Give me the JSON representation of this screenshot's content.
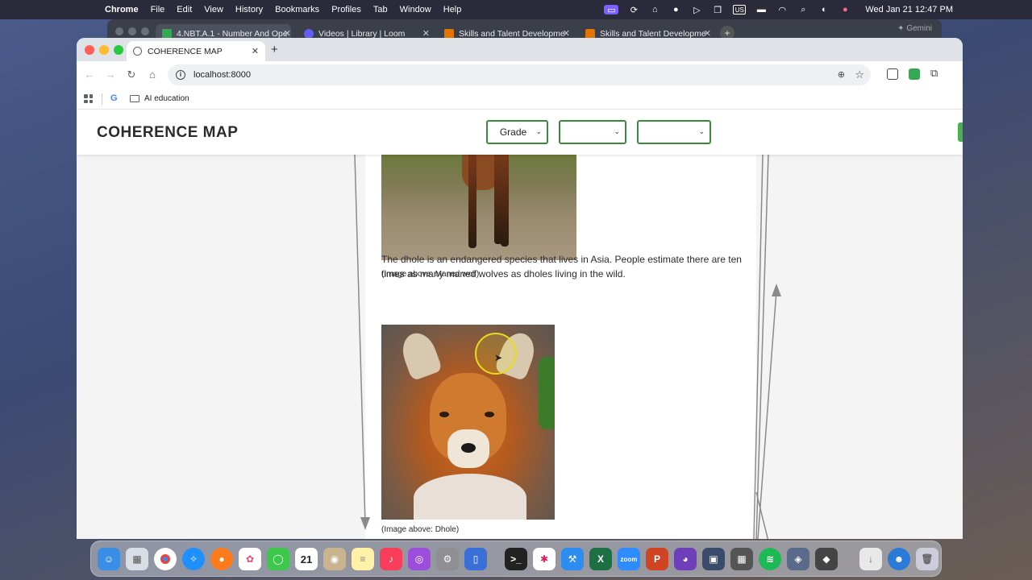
{
  "menubar": {
    "app_name": "Chrome",
    "items": [
      "File",
      "Edit",
      "View",
      "History",
      "Bookmarks",
      "Profiles",
      "Tab",
      "Window",
      "Help"
    ],
    "clock": "Wed Jan 21  12:47 PM"
  },
  "background_tabs": [
    {
      "label": "4.NBT.A.1 - Number And Ope",
      "color": "#34a853"
    },
    {
      "label": "Videos | Library | Loom",
      "color": "#625df5"
    },
    {
      "label": "Skills and Talent Developme",
      "color": "#e37400"
    },
    {
      "label": "Skills and Talent Developme",
      "color": "#e37400"
    }
  ],
  "background_extra": "Gemini",
  "browser": {
    "active_tab_title": "COHERENCE MAP",
    "url": "localhost:8000",
    "bookmark_folder": "AI education"
  },
  "app": {
    "title": "COHERENCE MAP",
    "grade_select": "Grade",
    "select_2": "",
    "select_3": ""
  },
  "content": {
    "caption_wolf": "(Image above: Maned wolf)",
    "paragraph": "The dhole is an endangered species that lives in Asia. People estimate there are ten times as many maned wolves as dholes living in the wild.",
    "caption_dhole": "(Image above: Dhole)"
  },
  "dock": {
    "apps": [
      "finder",
      "launchpad",
      "chrome",
      "safari",
      "firefox",
      "photos",
      "messages",
      "calendar",
      "contacts",
      "notes",
      "music",
      "podcasts",
      "settings",
      "files",
      "terminal",
      "slack",
      "xcode",
      "excel",
      "zoom",
      "powerpoint",
      "github",
      "automator",
      "calculator",
      "spotify",
      "vpn",
      "box",
      "downloads",
      "finder-face",
      "trash"
    ],
    "calendar_day": "21",
    "zoom_label": "zoom"
  },
  "colors": {
    "select_border": "#3a8a3a",
    "cursor_highlight": "#e6dc1a"
  }
}
